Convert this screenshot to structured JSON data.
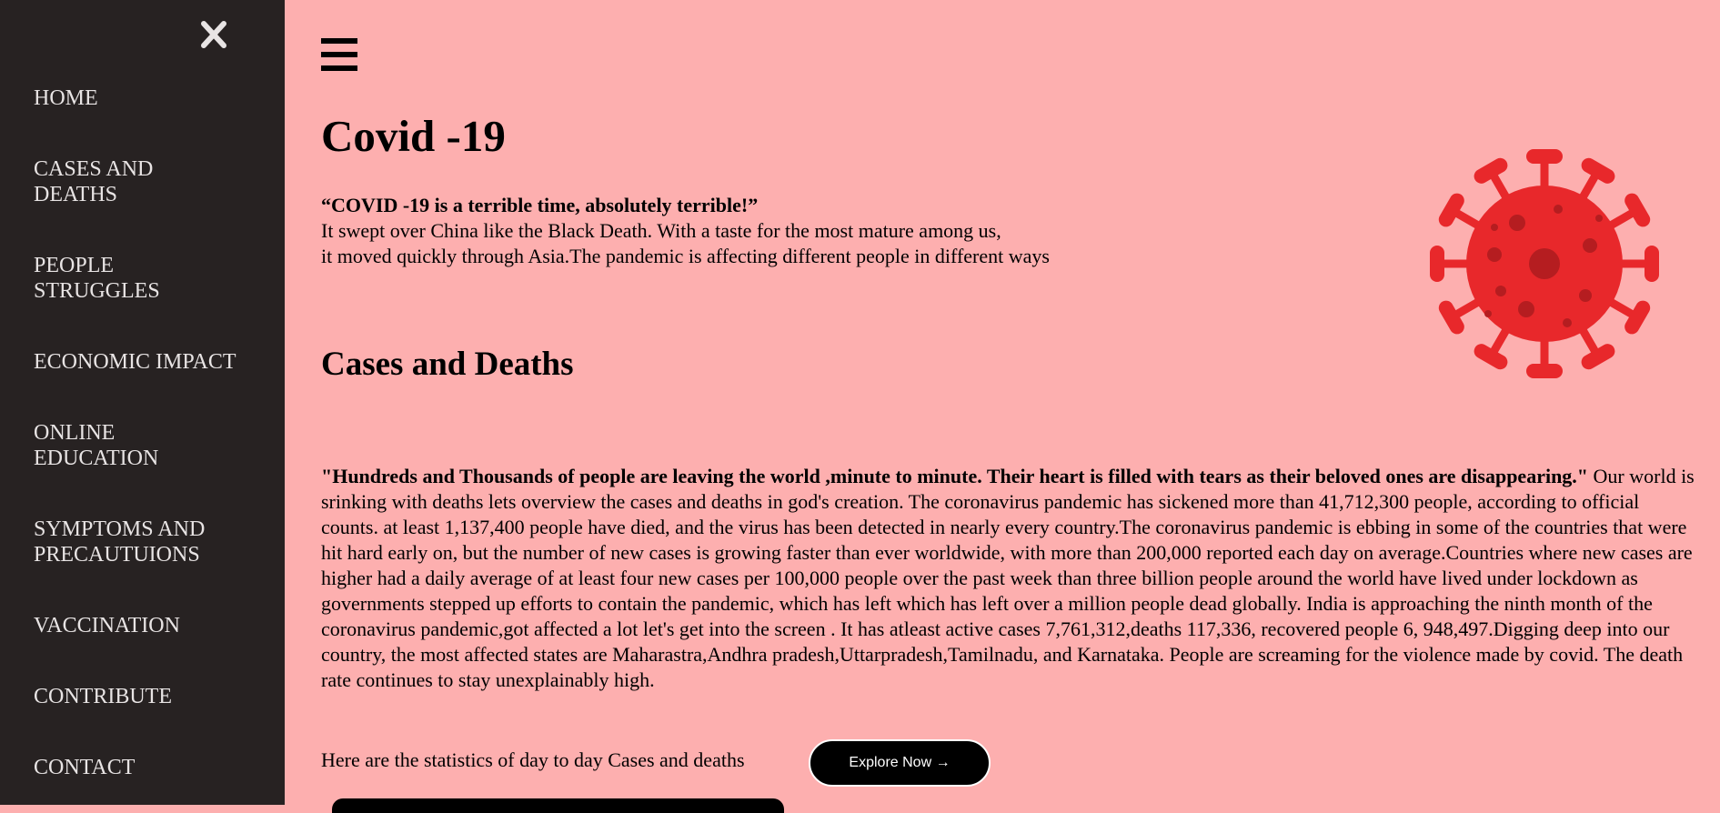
{
  "sidebar": {
    "close_icon": "close-icon",
    "items": [
      {
        "label": "HOME"
      },
      {
        "label": "CASES AND DEATHS"
      },
      {
        "label": "PEOPLE STRUGGLES"
      },
      {
        "label": "ECONOMIC IMPACT"
      },
      {
        "label": "ONLINE EDUCATION"
      },
      {
        "label": "SYMPTOMS AND PRECAUTUIONS"
      },
      {
        "label": "VACCINATION"
      },
      {
        "label": "CONTRIBUTE"
      },
      {
        "label": "CONTACT"
      }
    ]
  },
  "header": {
    "menu_icon": "hamburger-menu-icon"
  },
  "main": {
    "title": "Covid -19",
    "quote": "“COVID -19 is a terrible time, absolutely terrible!”",
    "intro_line1": "It swept over China like the Black Death. With a taste for the most mature among us,",
    "intro_line2": "it moved quickly through Asia.The pandemic is affecting different people in different ways",
    "section_title": "Cases and Deaths",
    "article_quote": "\"Hundreds and Thousands of people are leaving the world ,minute to minute. Their heart is filled with tears as their beloved ones are disappearing.\"",
    "article_body": " Our world is srinking with deaths lets overview the cases and deaths in god's creation. The coronavirus pandemic has sickened more than 41,712,300 people, according to official counts. at least 1,137,400 people have died, and the virus has been detected in nearly every country.The coronavirus pandemic is ebbing in some of the countries that were hit hard early on, but the number of new cases is growing faster than ever worldwide, with more than 200,000 reported each day on average.Countries where new cases are higher had a daily average of at least four new cases per 100,000 people over the past week than three billion people around the world have lived under lockdown as governments stepped up efforts to contain the pandemic, which has left which has left over a million people dead globally. India is approaching the ninth month of the coronavirus pandemic,got affected a lot let's get into the screen . It has atleast active cases 7,761,312,deaths 117,336, recovered people 6, 948,497.Digging deep into our country, the most affected states are Maharastra,Andhra pradesh,Uttarpradesh,Tamilnadu, and Karnataka. People are screaming for the violence made by covid. The death rate continues to stay unexplainably high.",
    "stats_text": "Here are the statistics of day to day Cases and deaths",
    "explore_label": "Explore Now →",
    "virus_image": "virus-icon"
  },
  "colors": {
    "background": "#fdafaf",
    "sidebar": "#272222",
    "virus": "#e8282b"
  }
}
